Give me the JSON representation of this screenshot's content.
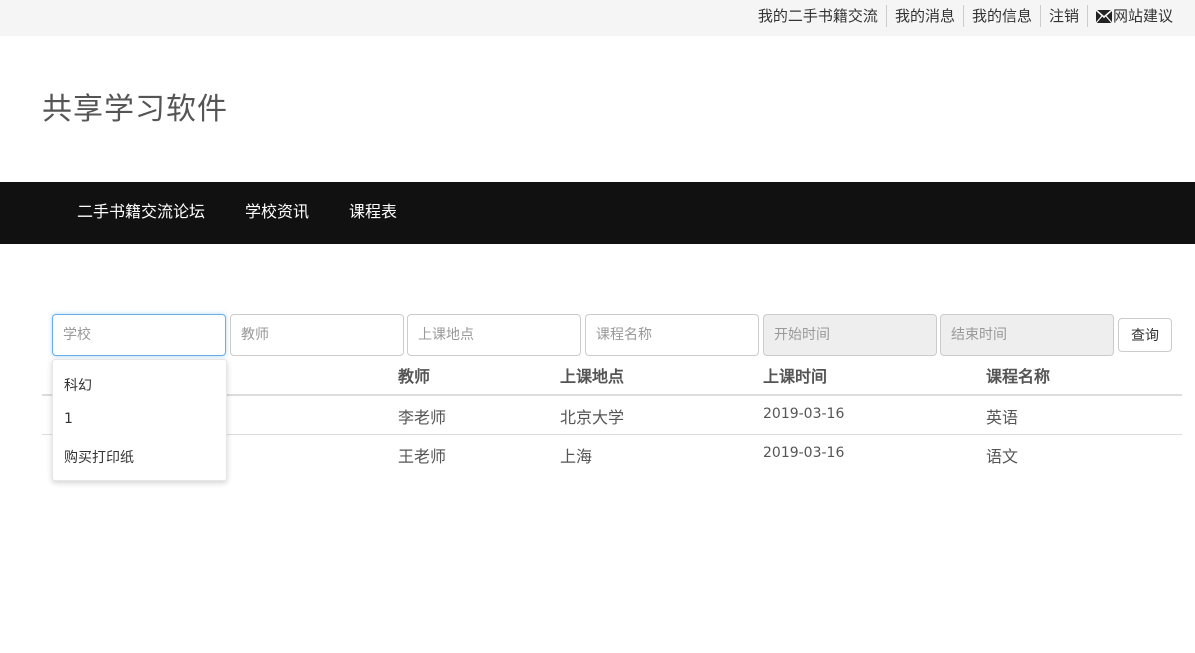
{
  "top_links": {
    "exchange": "我的二手书籍交流",
    "messages": "我的消息",
    "info": "我的信息",
    "logout": "注销",
    "feedback": "网站建议",
    "feedback_icon": "envelope-icon"
  },
  "site_title": "共享学习软件",
  "nav": {
    "items": [
      "二手书籍交流论坛",
      "学校资讯",
      "课程表"
    ]
  },
  "search": {
    "school_placeholder": "学校",
    "teacher_placeholder": "教师",
    "location_placeholder": "上课地点",
    "course_placeholder": "课程名称",
    "start_placeholder": "开始时间",
    "end_placeholder": "结束时间",
    "query_label": "查询"
  },
  "table": {
    "headers": {
      "teacher": "教师",
      "location": "上课地点",
      "time": "上课时间",
      "course": "课程名称"
    },
    "rows": [
      {
        "teacher": "李老师",
        "location": "北京大学",
        "time": "2019-03-16",
        "course": "英语"
      },
      {
        "teacher": "王老师",
        "location": "上海",
        "time": "2019-03-16",
        "course": "语文"
      }
    ]
  },
  "autocomplete": {
    "options": [
      "科幻",
      "1",
      "购买打印纸"
    ]
  },
  "colors": {
    "navbar": "#111111",
    "topbar": "#f5f5f5",
    "focus_border": "#66afe9"
  }
}
